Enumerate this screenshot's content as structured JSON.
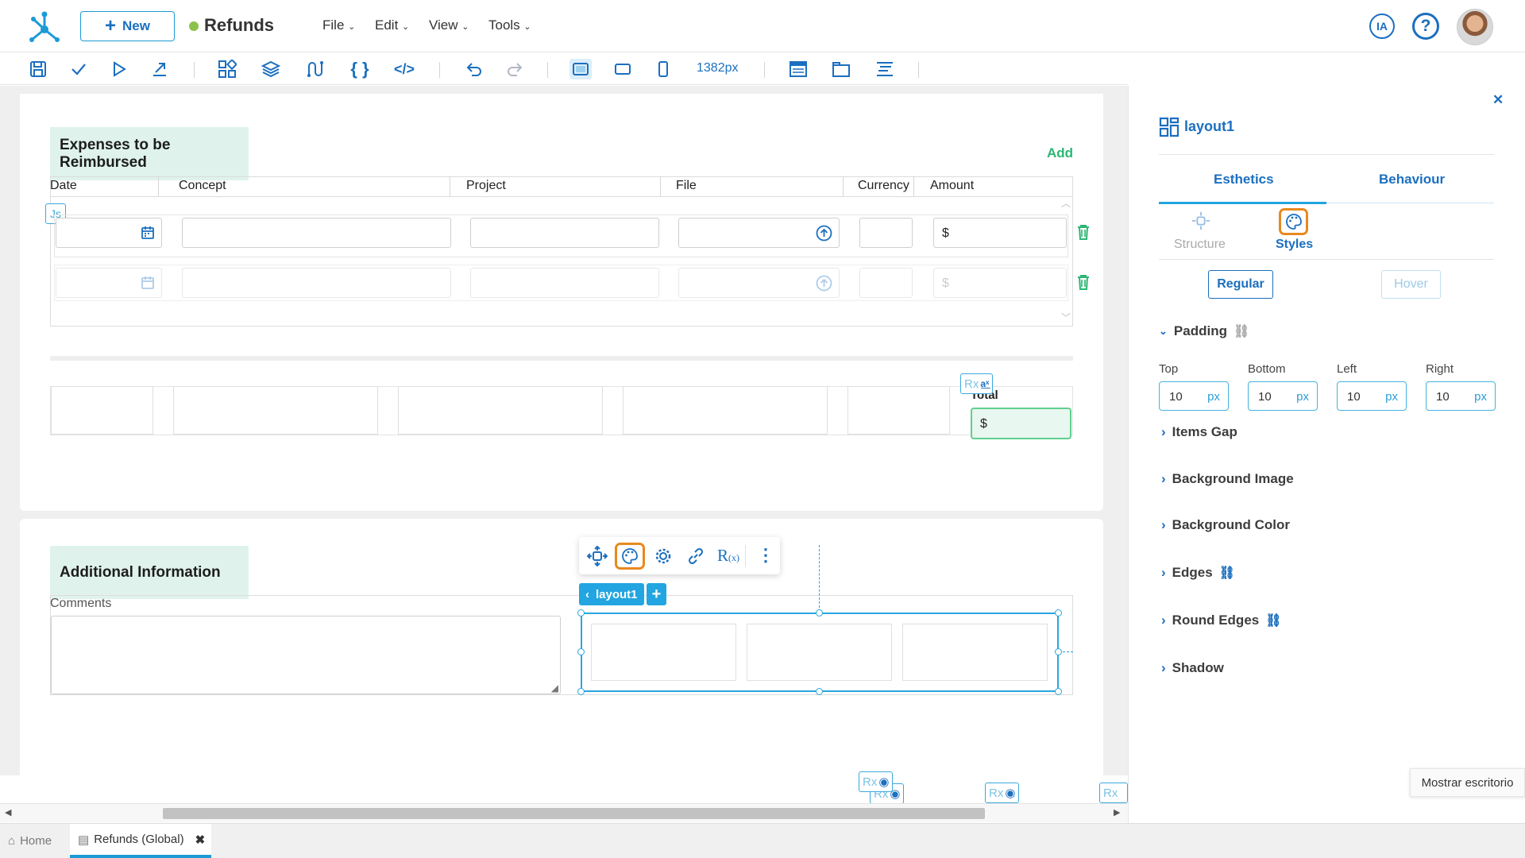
{
  "app": {
    "doc_title": "Refunds",
    "new_label": "New",
    "status_color": "#8bc34a",
    "accent": "#1b9ad6"
  },
  "menu": [
    "File",
    "Edit",
    "View",
    "Tools"
  ],
  "header_right": {
    "ia_label": "IA"
  },
  "toolbar": {
    "width_label": "1382px"
  },
  "expenses": {
    "title": "Expenses to be Reimbursed",
    "add_label": "Add",
    "columns": [
      "Date",
      "Concept",
      "Project",
      "File",
      "Currency",
      "Amount"
    ],
    "js_badge": "Js",
    "currency_symbol": "$"
  },
  "totals": {
    "label": "Total",
    "rx": "Rx",
    "currency_symbol": "$"
  },
  "additional": {
    "title": "Additional Information",
    "comments_label": "Comments"
  },
  "layout_chip": {
    "label": "layout1"
  },
  "rx_chips": [
    "Rx",
    "Rx",
    "Rx",
    "Rx"
  ],
  "panel": {
    "title": "layout1",
    "tabs": [
      "Esthetics",
      "Behaviour"
    ],
    "subtabs": [
      "Structure",
      "Styles"
    ],
    "states": [
      "Regular",
      "Hover"
    ],
    "padding": {
      "title": "Padding",
      "fields": [
        {
          "label": "Top",
          "value": "10",
          "unit": "px"
        },
        {
          "label": "Bottom",
          "value": "10",
          "unit": "px"
        },
        {
          "label": "Left",
          "value": "10",
          "unit": "px"
        },
        {
          "label": "Right",
          "value": "10",
          "unit": "px"
        }
      ]
    },
    "sections": [
      "Items Gap",
      "Background Image",
      "Background Color",
      "Edges",
      "Round Edges",
      "Shadow"
    ]
  },
  "tooltip": "Mostrar escritorio",
  "bottom_tabs": [
    {
      "label": "Home"
    },
    {
      "label": "Refunds (Global)"
    }
  ]
}
